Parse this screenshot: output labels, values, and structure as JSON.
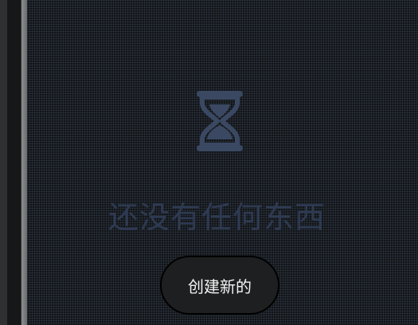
{
  "empty_state": {
    "icon": "hourglass-icon",
    "message": "还没有任何东西",
    "create_button_label": "创建新的"
  },
  "colors": {
    "icon": "#3a4862",
    "message": "#2e3a52",
    "button_bg": "#1e1f20",
    "button_text": "#f2f2f2"
  }
}
